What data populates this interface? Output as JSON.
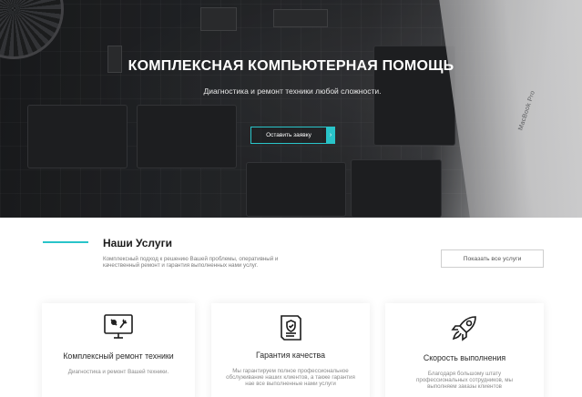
{
  "hero": {
    "title": "КОМПЛЕКСНАЯ КОМПЬЮТЕРНАЯ ПОМОЩЬ",
    "subtitle": "Диагностика и ремонт техники любой сложности.",
    "cta_label": "Оставить заявку",
    "cta_arrow": "›",
    "laptop_text": "MacBook Pro"
  },
  "services": {
    "title": "Наши Услуги",
    "description": "Комплексный подход к решению Вашей проблемы, оперативный и качественный ремонт и гарантия выполненных нами услуг.",
    "show_all_label": "Показать все услуги",
    "cards": [
      {
        "icon": "monitor-tools-icon",
        "title": "Комплексный ремонт техники",
        "text": "Диагностика и ремонт Вашей техники."
      },
      {
        "icon": "certificate-icon",
        "title": "Гарантия качества",
        "text": "Мы гарантируем полное профессиональное обслуживание наших клиентов, а также гарантия нае все выполненные нами услуги"
      },
      {
        "icon": "rocket-icon",
        "title": "Скорость выполнения",
        "text": "Благодаря большому штату профессиональных сотрудников, мы выполняем заказы клиентов"
      }
    ]
  },
  "colors": {
    "accent": "#29c4c9",
    "heading": "#1c1c1c",
    "muted": "#7a7a7a"
  }
}
